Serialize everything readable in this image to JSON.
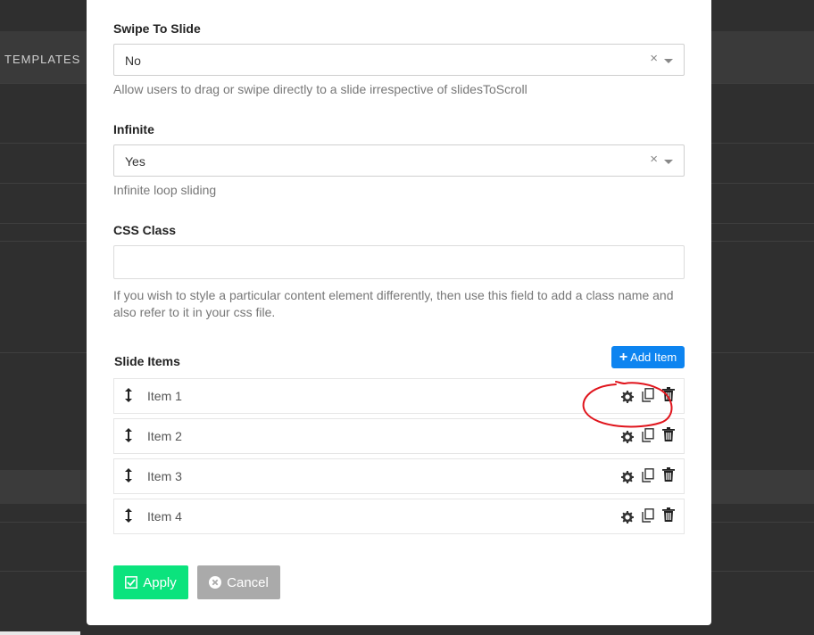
{
  "background": {
    "templates_label": "TEMPLATES"
  },
  "fields": {
    "swipe_to_slide": {
      "label": "Swipe To Slide",
      "value": "No",
      "clear": "×",
      "help": "Allow users to drag or swipe directly to a slide irrespective of slidesToScroll"
    },
    "infinite": {
      "label": "Infinite",
      "value": "Yes",
      "clear": "×",
      "help": "Infinite loop sliding"
    },
    "css_class": {
      "label": "CSS Class",
      "value": "",
      "help": "If you wish to style a particular content element differently, then use this field to add a class name and also refer to it in your css file."
    }
  },
  "slide_items": {
    "label": "Slide Items",
    "add_button": "Add Item",
    "items": [
      "Item 1",
      "Item 2",
      "Item 3",
      "Item 4"
    ]
  },
  "actions": {
    "apply": "Apply",
    "cancel": "Cancel"
  },
  "colors": {
    "accent_blue": "#0d84f0",
    "apply_green": "#0be37d",
    "cancel_gray": "#aaaaaa",
    "annotation_red": "#e0141c"
  }
}
